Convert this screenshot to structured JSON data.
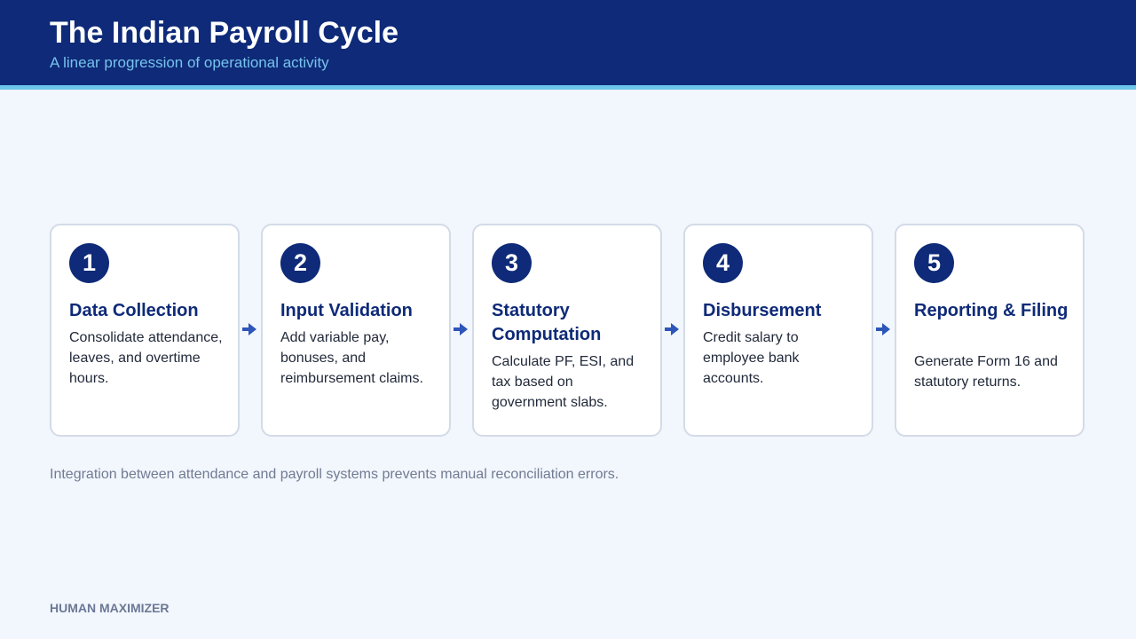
{
  "header": {
    "title": "The Indian Payroll Cycle",
    "subtitle": "A linear progression of operational activity"
  },
  "steps": [
    {
      "number": "1",
      "title": "Data Collection",
      "description": "Consolidate attendance, leaves, and overtime hours."
    },
    {
      "number": "2",
      "title": "Input Validation",
      "description": "Add variable pay, bonuses, and reimbursement claims."
    },
    {
      "number": "3",
      "title": "Statutory Computation",
      "description": "Calculate PF, ESI, and tax based on government slabs."
    },
    {
      "number": "4",
      "title": "Disbursement",
      "description": "Credit salary to employee bank accounts."
    },
    {
      "number": "5",
      "title": "Reporting & Filing",
      "description": "Generate Form 16 and statutory returns."
    }
  ],
  "connector_icon": "arrow-right-icon",
  "footer": {
    "note": "Integration between attendance and payroll systems prevents manual reconciliation errors.",
    "brand": "HUMAN MAXIMIZER"
  },
  "colors": {
    "header_background": "#0e2a78",
    "accent_stripe": "#6cc6ea",
    "page_background": "#f2f6fd",
    "badge_background": "#0e2a78",
    "arrow": "#2d56b8"
  }
}
